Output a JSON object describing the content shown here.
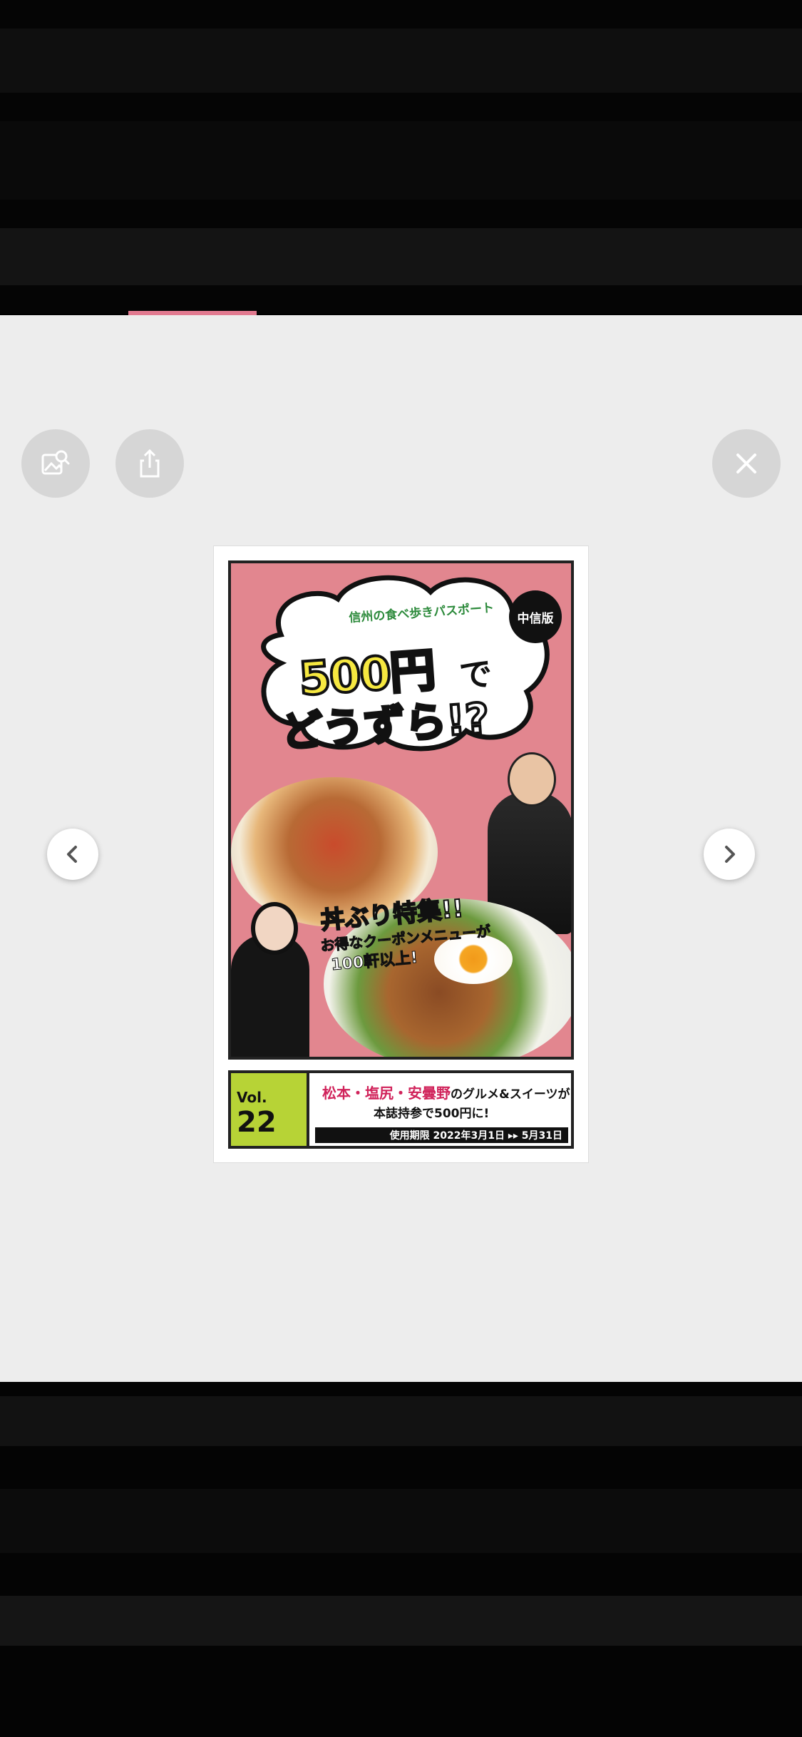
{
  "toolbar": {
    "visual_lookup_icon": "image-search-icon",
    "share_icon": "share-icon",
    "close_icon": "close-icon"
  },
  "navigation": {
    "prev_icon": "chevron-left-icon",
    "next_icon": "chevron-right-icon"
  },
  "poster": {
    "tagline": "信州の食べ歩きパスポート",
    "edition": "中信版",
    "price": "500円",
    "price_suffix": "で",
    "headline": "どうずら!?",
    "feature": "丼ぶり特集!!",
    "coupon_line": "お得なクーポンメニューが",
    "coupon_count": "100軒以上!",
    "vol_label": "Vol.",
    "vol_number": "22",
    "area_names": "松本・塩尻・安曇野",
    "area_suffix": "のグルメ&スイーツが",
    "note": "本誌持参で500円に!",
    "period": "使用期限 2022年3月1日 ▸▸ 5月31日"
  },
  "colors": {
    "viewer_bg": "#ededed",
    "poster_pink": "#e2868f",
    "vol_green": "#b7d336",
    "price_yellow": "#f6e840"
  }
}
